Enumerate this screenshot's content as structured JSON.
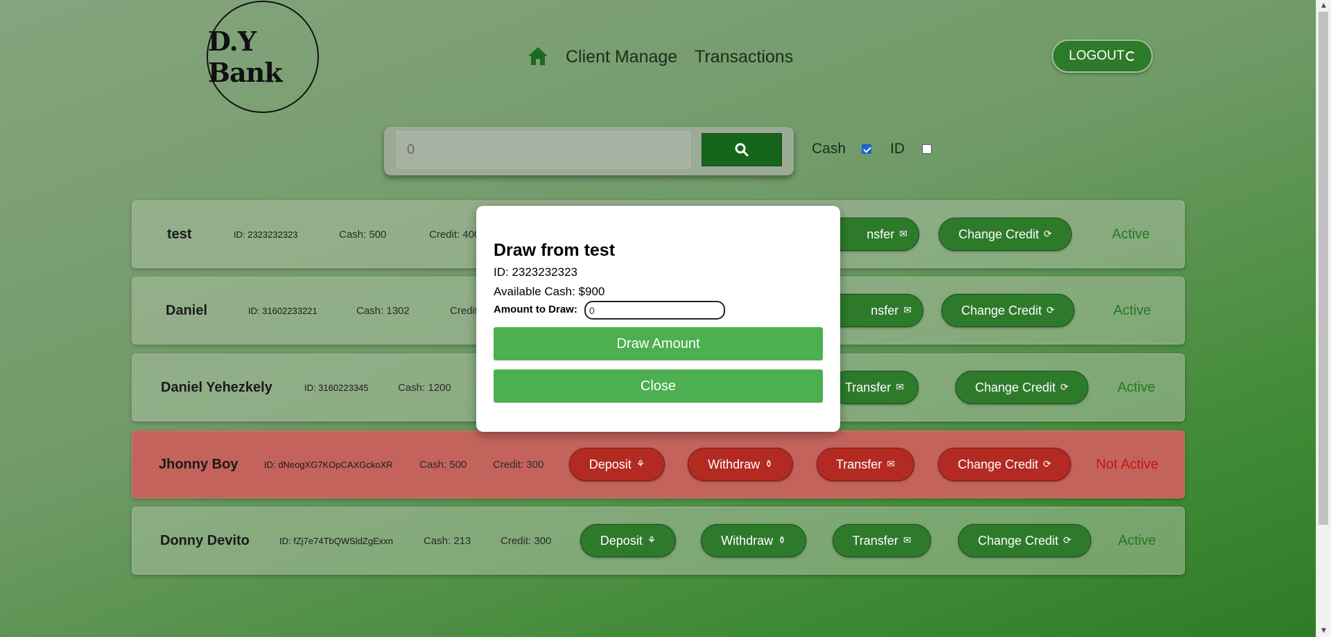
{
  "brand": {
    "logo_text": "D.Y Bank"
  },
  "nav": {
    "home_icon": "home-icon",
    "client_manage": "Client Manage",
    "transactions": "Transactions",
    "logout": "LOGOUT"
  },
  "search": {
    "value": "0",
    "icon": "search-icon",
    "filters": [
      {
        "label": "Cash",
        "checked": true
      },
      {
        "label": "ID",
        "checked": false
      }
    ]
  },
  "clients": [
    {
      "name": "test",
      "id": "ID: 2323232323",
      "cash": "Cash: 500",
      "credit": "Credit: 400",
      "status": "Active"
    },
    {
      "name": "Daniel",
      "id": "ID: 31602233221",
      "cash": "Cash: 1302",
      "credit": "Credit",
      "status": "Active"
    },
    {
      "name": "Daniel Yehezkely",
      "id": "ID: 3160223345",
      "cash": "Cash: 1200",
      "status": "Active"
    },
    {
      "name": "Jhonny Boy",
      "id": "ID: dNeogXG7KOpCAXGckoXR",
      "cash": "Cash: 500",
      "credit": "Credit: 300",
      "status": "Not Active"
    },
    {
      "name": "Donny Devito",
      "id": "ID: fZj7e74TbQWSldZgExxn",
      "cash": "Cash: 213",
      "credit": "Credit: 300",
      "status": "Active"
    }
  ],
  "actions": {
    "deposit": "Deposit",
    "withdraw": "Withdraw",
    "transfer": "Transfer",
    "transfer_partial": "nsfer",
    "change_credit": "Change Credit"
  },
  "colors": {
    "active_row": "#aabea0",
    "inactive_row": "#c4635c",
    "button_green": "#2d7a2b",
    "button_red": "#b32a22",
    "modal_button": "#4caf50"
  },
  "modal": {
    "title": "Draw from test",
    "id_line": "ID: 2323232323",
    "cash_line": "Available Cash: $900",
    "amount_label": "Amount to Draw:",
    "amount_value": "0",
    "draw_button": "Draw Amount",
    "close_button": "Close"
  }
}
